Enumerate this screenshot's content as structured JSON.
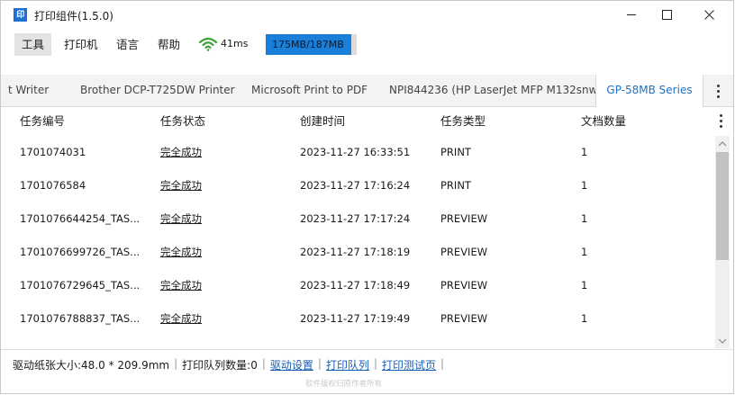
{
  "window": {
    "app_icon": "印",
    "title": "打印组件(1.5.0)"
  },
  "menu": {
    "items": [
      {
        "label": "工具"
      },
      {
        "label": "打印机"
      },
      {
        "label": "语言"
      },
      {
        "label": "帮助"
      }
    ],
    "latency": "41ms",
    "memory": {
      "text": "175MB/187MB",
      "used_fraction": 0.936
    }
  },
  "tabs": [
    {
      "label": "t Writer"
    },
    {
      "label": "Brother DCP-T725DW Printer"
    },
    {
      "label": "Microsoft Print to PDF"
    },
    {
      "label": "NPI844236 (HP LaserJet MFP M132snw)"
    },
    {
      "label": "GP-58MB Series",
      "active": true
    }
  ],
  "table": {
    "columns": [
      "任务编号",
      "任务状态",
      "创建时间",
      "任务类型",
      "文档数量"
    ],
    "rows": [
      [
        "1701074031",
        "完全成功",
        "2023-11-27 16:33:51",
        "PRINT",
        "1"
      ],
      [
        "1701076584",
        "完全成功",
        "2023-11-27 17:16:24",
        "PRINT",
        "1"
      ],
      [
        "1701076644254_TAS...",
        "完全成功",
        "2023-11-27 17:17:24",
        "PREVIEW",
        "1"
      ],
      [
        "1701076699726_TAS...",
        "完全成功",
        "2023-11-27 17:18:19",
        "PREVIEW",
        "1"
      ],
      [
        "1701076729645_TAS...",
        "完全成功",
        "2023-11-27 17:18:49",
        "PREVIEW",
        "1"
      ],
      [
        "1701076788837_TAS...",
        "完全成功",
        "2023-11-27 17:19:49",
        "PREVIEW",
        "1"
      ]
    ]
  },
  "status": {
    "paper_size": "驱动纸张大小:48.0 * 209.9mm",
    "queue_count": "打印队列数量:0",
    "driver_settings": "驱动设置",
    "print_queue": "打印队列",
    "print_test_page": "打印测试页",
    "separator": "|",
    "watermark": "软件版权归原作者所有"
  },
  "colors": {
    "accent": "#1a7fd9",
    "active_tab_text": "#1b72c4",
    "link": "#1b5fb5",
    "wifi": "#3aa33a"
  },
  "icons": [
    "app-logo-icon",
    "minimize-icon",
    "maximize-icon",
    "close-icon",
    "wifi-icon",
    "more-vertical-icon",
    "scroll-up-icon",
    "scroll-down-icon"
  ]
}
